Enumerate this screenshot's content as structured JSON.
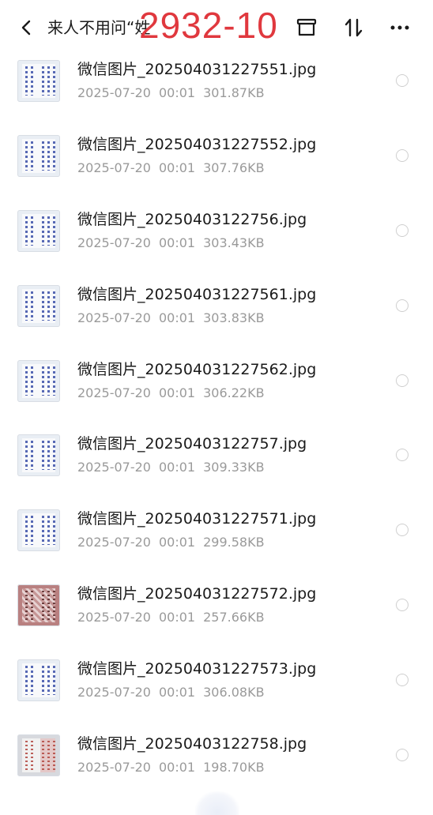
{
  "header": {
    "title": "来人不用问“姓",
    "overlay_label": "2932-10"
  },
  "files": [
    {
      "name": "微信图片_202504031227551.jpg",
      "date": "2025-07-20",
      "time": "00:01",
      "size": "301.87KB",
      "thumb": "document"
    },
    {
      "name": "微信图片_202504031227552.jpg",
      "date": "2025-07-20",
      "time": "00:01",
      "size": "307.76KB",
      "thumb": "document"
    },
    {
      "name": "微信图片_20250403122756.jpg",
      "date": "2025-07-20",
      "time": "00:01",
      "size": "303.43KB",
      "thumb": "document"
    },
    {
      "name": "微信图片_202504031227561.jpg",
      "date": "2025-07-20",
      "time": "00:01",
      "size": "303.83KB",
      "thumb": "document"
    },
    {
      "name": "微信图片_202504031227562.jpg",
      "date": "2025-07-20",
      "time": "00:01",
      "size": "306.22KB",
      "thumb": "document"
    },
    {
      "name": "微信图片_20250403122757.jpg",
      "date": "2025-07-20",
      "time": "00:01",
      "size": "309.33KB",
      "thumb": "document"
    },
    {
      "name": "微信图片_202504031227571.jpg",
      "date": "2025-07-20",
      "time": "00:01",
      "size": "299.58KB",
      "thumb": "document"
    },
    {
      "name": "微信图片_202504031227572.jpg",
      "date": "2025-07-20",
      "time": "00:01",
      "size": "257.66KB",
      "thumb": "photo"
    },
    {
      "name": "微信图片_202504031227573.jpg",
      "date": "2025-07-20",
      "time": "00:01",
      "size": "306.08KB",
      "thumb": "document"
    },
    {
      "name": "微信图片_20250403122758.jpg",
      "date": "2025-07-20",
      "time": "00:01",
      "size": "198.70KB",
      "thumb": "mixed"
    }
  ],
  "icons": {
    "back": "chevron-left-icon",
    "archive": "archive-box-icon",
    "sort": "sort-arrows-icon",
    "more": "more-horizontal-icon",
    "select": "radio-circle-icon"
  },
  "colors": {
    "overlay_red": "#e0383e",
    "meta_gray": "#9a9a9a",
    "radio_gray": "#cfcfcf"
  }
}
